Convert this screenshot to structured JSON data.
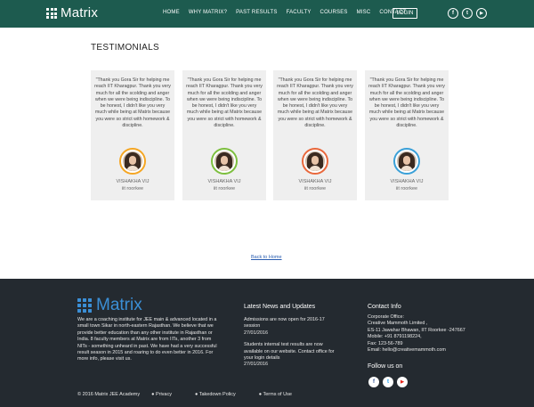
{
  "header": {
    "brand": "Matrix",
    "nav": [
      "HOME",
      "WHY MATRIX?",
      "PAST RESULTS",
      "FACULTY",
      "COURSES",
      "MISC",
      "CONTACT"
    ],
    "login_label": "LOGIN",
    "social": [
      {
        "icon": "facebook-icon",
        "glyph": "f"
      },
      {
        "icon": "twitter-icon",
        "glyph": "t"
      },
      {
        "icon": "youtube-icon",
        "glyph": "▶"
      }
    ]
  },
  "testimonials": {
    "title": "TESTIMONIALS",
    "items": [
      {
        "quote": "\"Thank you Gora Sir for helping me reach IIT Kharagpur. Thank you very much for all the scolding and anger when we were being indiscipline. To be honest, I didn't like you very much while being at Matrix because you were so strict with homework & discipline.",
        "name": "VISHAKHA VIJ",
        "college": "iit roorkee",
        "ring_color": "#f5a623"
      },
      {
        "quote": "\"Thank you Gora Sir for helping me reach IIT Kharagpur. Thank you very much for all the scolding and anger when we were being indiscipline. To be honest, I didn't like you very much while being at Matrix because you were so strict with homework & discipline.",
        "name": "VISHAKHA VIJ",
        "college": "iit roorkee",
        "ring_color": "#7dbf3f"
      },
      {
        "quote": "\"Thank you Gora Sir for helping me reach IIT Kharagpur. Thank you very much for all the scolding and anger when we were being indiscipline. To be honest, I didn't like you very much while being at Matrix because you were so strict with homework & discipline.",
        "name": "VISHAKHA VIJ",
        "college": "iit roorkee",
        "ring_color": "#e9683c"
      },
      {
        "quote": "\"Thank you Gora Sir for helping me reach IIT Kharagpur. Thank you very much for all the scolding and anger when we were being indiscipline. To be honest, I didn't like you very much while being at Matrix because you were so strict with homework & discipline.",
        "name": "VISHAKHA VIJ",
        "college": "iit roorkee",
        "ring_color": "#3aa0d8"
      }
    ]
  },
  "back_link": "Back to Home",
  "footer": {
    "brand": "Matrix",
    "about": "We are a coaching institute for JEE main & advanced located in a small town Sikar in north-eastern Rajasthan. We believe that we provide better education than any other institute in Rajasthan or India. 8 faculty members at Matrix are from IITs, another 3 from NITs - something unheard in past. We have had a very successful result season in 2015 and roaring to do even better in 2016. For more info, please visit us.",
    "news_title": "Latest News and Updates",
    "news": [
      {
        "text": "Admissions are now open for 2016-17 session",
        "date": "27/01/2016"
      },
      {
        "text": "Students internal test results are now available on our website. Contact office for your login details",
        "date": "27/01/2016"
      }
    ],
    "contact_title": "Contact Info",
    "contact_lines": [
      "Corporate Office:",
      "Creative Mammoth Limited ,",
      "ES-11 Jawahar Bhawan, IIT Roorkee -247667",
      "Mobile: +91 8791198224,",
      "Fax: 123-56-789",
      "Email: hello@creativemammoth.com"
    ],
    "follow_title": "Follow us on",
    "follow_social": [
      {
        "icon": "facebook-icon",
        "glyph": "f",
        "color": "#3b5998"
      },
      {
        "icon": "twitter-icon",
        "glyph": "t",
        "color": "#1da1f2"
      },
      {
        "icon": "youtube-icon",
        "glyph": "▶",
        "color": "#e62117"
      }
    ],
    "copyright": "© 2016 Matrix JEE Academy",
    "links": [
      "Privacy",
      "Takedown Policy",
      "Terms of Use"
    ]
  }
}
